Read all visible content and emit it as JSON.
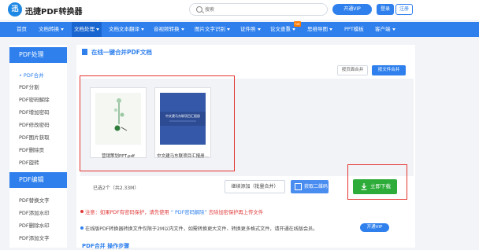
{
  "header": {
    "logo_char": "迅",
    "app_title": "迅捷PDF转换器",
    "search_placeholder": "搜索",
    "vip_label": "开通VIP",
    "login_label": "登录",
    "register_label": "注册"
  },
  "nav": {
    "items": [
      {
        "label": "首页",
        "caret": false
      },
      {
        "label": "文档转换",
        "caret": true
      },
      {
        "label": "文档处理",
        "caret": true
      },
      {
        "label": "文档文本翻译",
        "caret": true
      },
      {
        "label": "音视频转换",
        "caret": true
      },
      {
        "label": "图片文字识别",
        "caret": true
      },
      {
        "label": "证件照",
        "caret": true
      },
      {
        "label": "论文查重",
        "caret": true
      },
      {
        "label": "思维导图",
        "caret": true
      },
      {
        "label": "PPT模板",
        "caret": false
      },
      {
        "label": "客户端",
        "caret": true
      }
    ],
    "active_index": 2,
    "hot_badge": "hot"
  },
  "sidebar": {
    "section1_title": "PDF处理",
    "section1_items": [
      "PDF合并",
      "PDF分割",
      "PDF密码解除",
      "PDF增加密码",
      "PDF修改密码",
      "PDF图片获取",
      "PDF删除页",
      "PDF旋转"
    ],
    "active_item": "PDF合并",
    "section2_title": "PDF编辑",
    "section2_items": [
      "PDF替换文字",
      "PDF添加水印",
      "PDF删除水印",
      "PDF添加文字"
    ]
  },
  "main": {
    "title": "在线一键合并PDF文档",
    "sort_label": "按页面合并",
    "file_sort_label": "按文件合并",
    "files": [
      {
        "name": "营销策划PPT.pdf"
      },
      {
        "name": "中文建马东联项目汇报册..."
      }
    ],
    "thumb_text": "中文建马东联项目汇报册",
    "count_text": "已选2个（共2.33M）",
    "continue_label": "继续添加（批量合并）",
    "link_label": "获取二维码",
    "download_label": "立即下载",
    "notice1_a": "注意：如果PDF有密码保护，请先使用",
    "notice1_link": "“ PDF密码解除”",
    "notice1_b": "去除加密保护再上传文件",
    "notice2": "在线版PDF转换器转换文件仅限于2M以内文件，如需转换更大文件、转换更多格式文件，请开通在线版会员。",
    "vip_small_label": "开通VIP",
    "next_title": "PDF合并 操作步骤"
  },
  "colors": {
    "brand_blue": "#2f80ed",
    "download_green": "#2eac3a",
    "highlight_red": "#e3342f"
  }
}
